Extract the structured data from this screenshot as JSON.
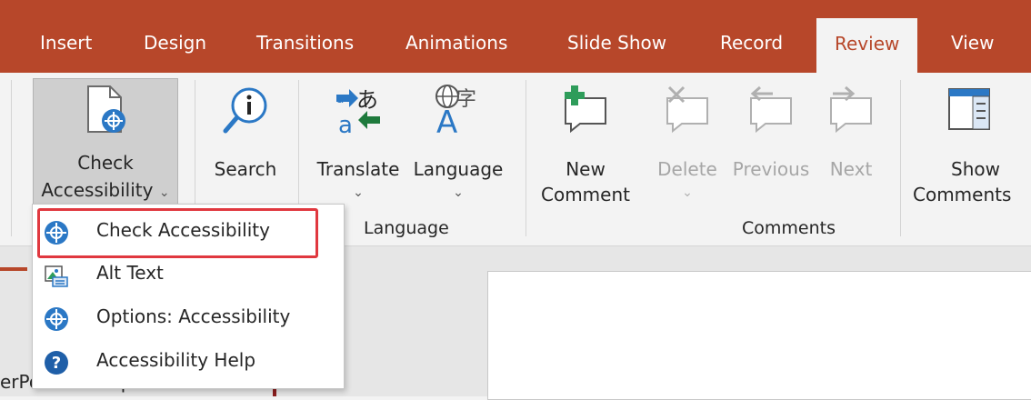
{
  "tabs": [
    "Insert",
    "Design",
    "Transitions",
    "Animations",
    "Slide Show",
    "Record",
    "Review",
    "View"
  ],
  "active_tab": "Review",
  "ribbon": {
    "check_accessibility": {
      "line1": "Check",
      "line2": "Accessibility",
      "chevron": "⌄"
    },
    "search": {
      "label": "Search"
    },
    "translate": {
      "label": "Translate",
      "chevron": "⌄"
    },
    "language": {
      "label": "Language",
      "chevron": "⌄"
    },
    "new_comment": {
      "line1": "New",
      "line2": "Comment"
    },
    "delete": {
      "label": "Delete",
      "chevron": "⌄"
    },
    "previous": {
      "label": "Previous"
    },
    "next": {
      "label": "Next"
    },
    "show_comments": {
      "line1": "Show",
      "line2": "Comments"
    },
    "groups": {
      "language": "Language",
      "comments": "Comments"
    }
  },
  "menu": {
    "items": [
      {
        "label": "Check Accessibility",
        "icon": "accessibility-icon"
      },
      {
        "label": "Alt Text",
        "icon": "alt-text-icon"
      },
      {
        "label": "Options: Accessibility",
        "icon": "accessibility-options-icon"
      },
      {
        "label": "Accessibility Help",
        "icon": "help-icon"
      }
    ]
  },
  "background_text": "erPoint Example",
  "colors": {
    "accent": "#b7472a",
    "highlight": "#e0383f",
    "help": "#1f5fa8"
  }
}
